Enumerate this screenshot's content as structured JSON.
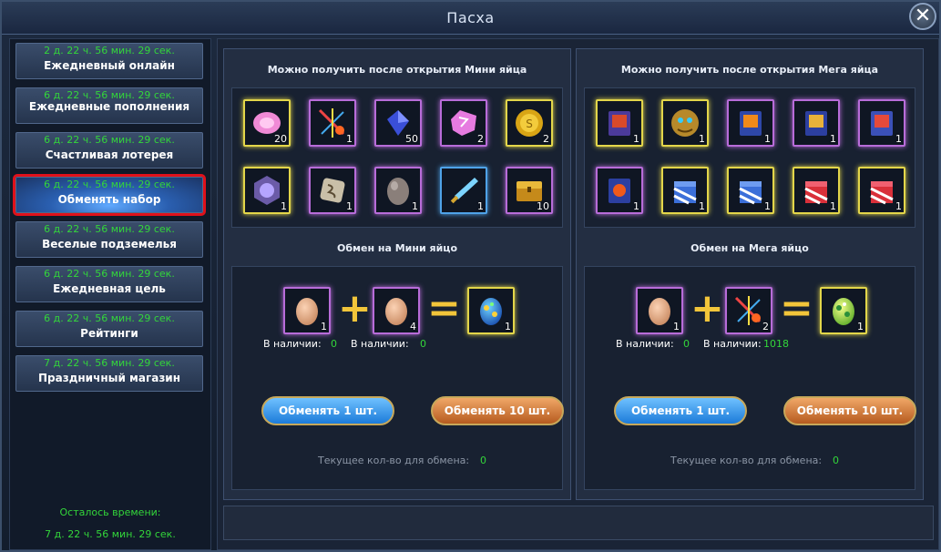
{
  "window": {
    "title": "Пасха",
    "close_symbol": "✕"
  },
  "sidebar": {
    "items": [
      {
        "timer": "2 д. 22 ч. 56 мин. 29 сек.",
        "label": "Ежедневный онлайн"
      },
      {
        "timer": "6 д. 22 ч. 56 мин. 29 сек.",
        "label": "Ежедневные пополнения"
      },
      {
        "timer": "6 д. 22 ч. 56 мин. 29 сек.",
        "label": "Счастливая лотерея"
      },
      {
        "timer": "6 д. 22 ч. 56 мин. 29 сек.",
        "label": "Обменять набор"
      },
      {
        "timer": "6 д. 22 ч. 56 мин. 29 сек.",
        "label": "Веселые подземелья"
      },
      {
        "timer": "6 д. 22 ч. 56 мин. 29 сек.",
        "label": "Ежедневная цель"
      },
      {
        "timer": "6 д. 22 ч. 56 мин. 29 сек.",
        "label": "Рейтинги"
      },
      {
        "timer": "7 д. 22 ч. 56 мин. 29 сек.",
        "label": "Праздничный магазин"
      }
    ],
    "remaining_label": "Осталось времени:",
    "remaining_value": "7 д. 22 ч. 56 мин. 29 сек."
  },
  "mini": {
    "rewards_title": "Можно получить после открытия Мини яйца",
    "rewards": [
      {
        "icon": "pink-gem-icon",
        "count": "20"
      },
      {
        "icon": "firework-icon",
        "count": "1"
      },
      {
        "icon": "blue-crystal-icon",
        "count": "50"
      },
      {
        "icon": "pink-stone-icon",
        "count": "2"
      },
      {
        "icon": "gold-coin-icon",
        "count": "2"
      },
      {
        "icon": "purple-amulet-icon",
        "count": "1"
      },
      {
        "icon": "rune-stone-icon",
        "count": "1"
      },
      {
        "icon": "grey-egg-icon",
        "count": "1"
      },
      {
        "icon": "blue-dagger-icon",
        "count": "1"
      },
      {
        "icon": "gold-chest-icon",
        "count": "10"
      }
    ],
    "exchange_title": "Обмен на Мини яйцо",
    "input1": {
      "icon": "egg-icon",
      "count": "1"
    },
    "input2": {
      "icon": "egg-icon",
      "count": "4"
    },
    "output": {
      "icon": "painted-egg-blue-icon",
      "count": "1"
    },
    "have_label": "В наличии:",
    "have1": "0",
    "have2": "0",
    "btn1": "Обменять 1 шт.",
    "btn10": "Обменять 10 шт.",
    "current_label": "Текущее кол-во для обмена:",
    "current_value": "0"
  },
  "mega": {
    "rewards_title": "Можно получить после открытия Мега яйца",
    "rewards": [
      {
        "icon": "book-icon",
        "count": "1"
      },
      {
        "icon": "gold-beast-icon",
        "count": "1"
      },
      {
        "icon": "book-icon",
        "count": "1"
      },
      {
        "icon": "book-icon",
        "count": "1"
      },
      {
        "icon": "book-icon",
        "count": "1"
      },
      {
        "icon": "book-icon",
        "count": "1"
      },
      {
        "icon": "blue-gift-icon",
        "count": "1"
      },
      {
        "icon": "blue-gift-icon",
        "count": "1"
      },
      {
        "icon": "red-gift-icon",
        "count": "1"
      },
      {
        "icon": "red-gift-icon",
        "count": "1"
      }
    ],
    "exchange_title": "Обмен на Мега яйцо",
    "input1": {
      "icon": "egg-icon",
      "count": "1"
    },
    "input2": {
      "icon": "firework-icon",
      "count": "2"
    },
    "output": {
      "icon": "painted-egg-green-icon",
      "count": "1"
    },
    "have_label": "В наличии:",
    "have1": "0",
    "have2": "1018",
    "btn1": "Обменять 1 шт.",
    "btn10": "Обменять 10 шт.",
    "current_label": "Текущее кол-во для обмена:",
    "current_value": "0"
  },
  "colors": {
    "timer_green": "#33d63a",
    "highlight_red": "#e0111b",
    "accent_gold": "#f2c53a"
  }
}
